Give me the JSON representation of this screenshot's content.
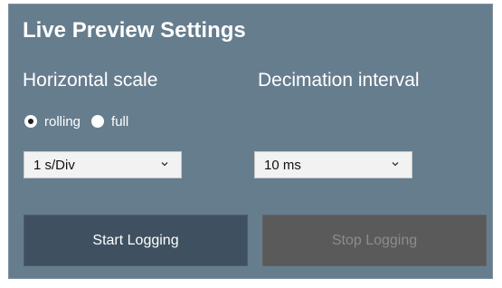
{
  "panel": {
    "title": "Live Preview Settings"
  },
  "horizontal_scale": {
    "label": "Horizontal scale",
    "options": {
      "rolling": "rolling",
      "full": "full"
    },
    "selected_mode": "rolling",
    "scale_value": "1 s/Div"
  },
  "decimation": {
    "label": "Decimation interval",
    "value": "10 ms"
  },
  "buttons": {
    "start_label": "Start Logging",
    "stop_label": "Stop Logging",
    "stop_enabled": false
  },
  "colors": {
    "panel_bg": "#667d8e",
    "start_button_bg": "#3f5060",
    "stop_button_bg": "#5a5a5a",
    "disabled_text": "#8c8c8c"
  },
  "icons": {
    "dropdown": "chevron-down-icon"
  }
}
